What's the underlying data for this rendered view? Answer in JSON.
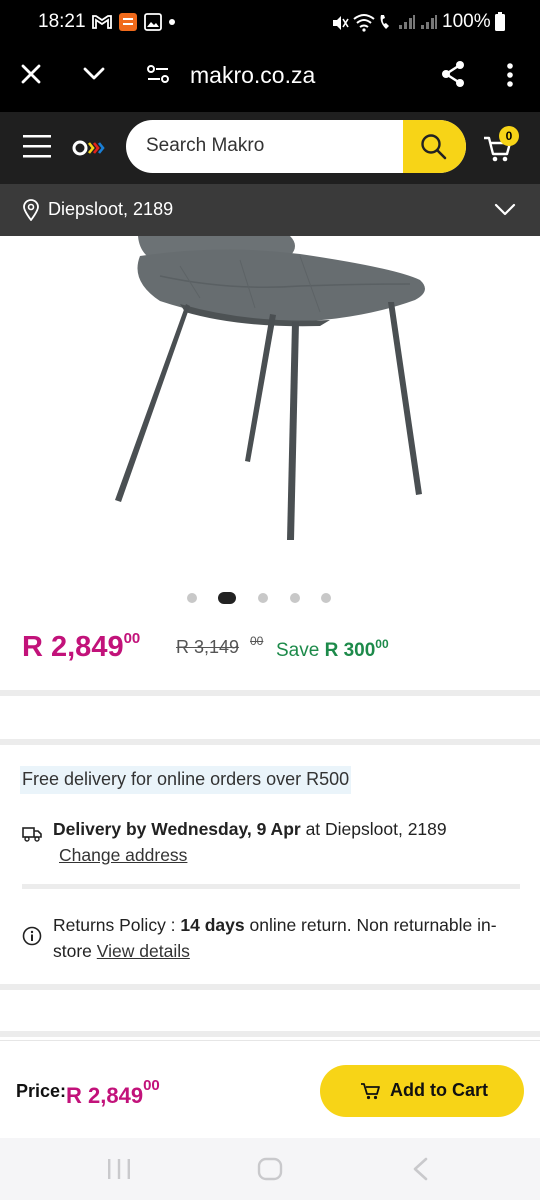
{
  "status_bar": {
    "time": "18:21",
    "battery": "100%"
  },
  "browser": {
    "url": "makro.co.za",
    "icons": [
      "close-icon",
      "chevron-down-icon",
      "site-settings-icon",
      "share-icon",
      "more-vert-icon"
    ]
  },
  "header": {
    "search_placeholder": "Search Makro",
    "cart_count": "0",
    "brand_color": "#f7d417"
  },
  "location": {
    "text": "Diepsloot, 2189"
  },
  "gallery": {
    "dots": 5,
    "active_index": 1
  },
  "pricing": {
    "price_main": "R 2,849",
    "price_cents": "00",
    "old_price": "R 3,149",
    "old_cents": "00",
    "save_label": "Save",
    "save_amount": "R 300",
    "save_cents": "00",
    "price_color": "#c2127a",
    "save_color": "#1d8a4a"
  },
  "delivery": {
    "free_delivery": "Free delivery for online orders over R500",
    "delivery_bold": "Delivery by Wednesday, 9 Apr",
    "delivery_rest": " at Diepsloot, 2189",
    "change_address": "Change address"
  },
  "returns": {
    "prefix": "Returns Policy : ",
    "days": "14 days",
    "rest": " online return. Non returnable in-store ",
    "view_details": "View details"
  },
  "bottom": {
    "price_label": "Price:",
    "price": "R 2,849",
    "price_cents": "00",
    "add_to_cart": "Add to Cart"
  }
}
